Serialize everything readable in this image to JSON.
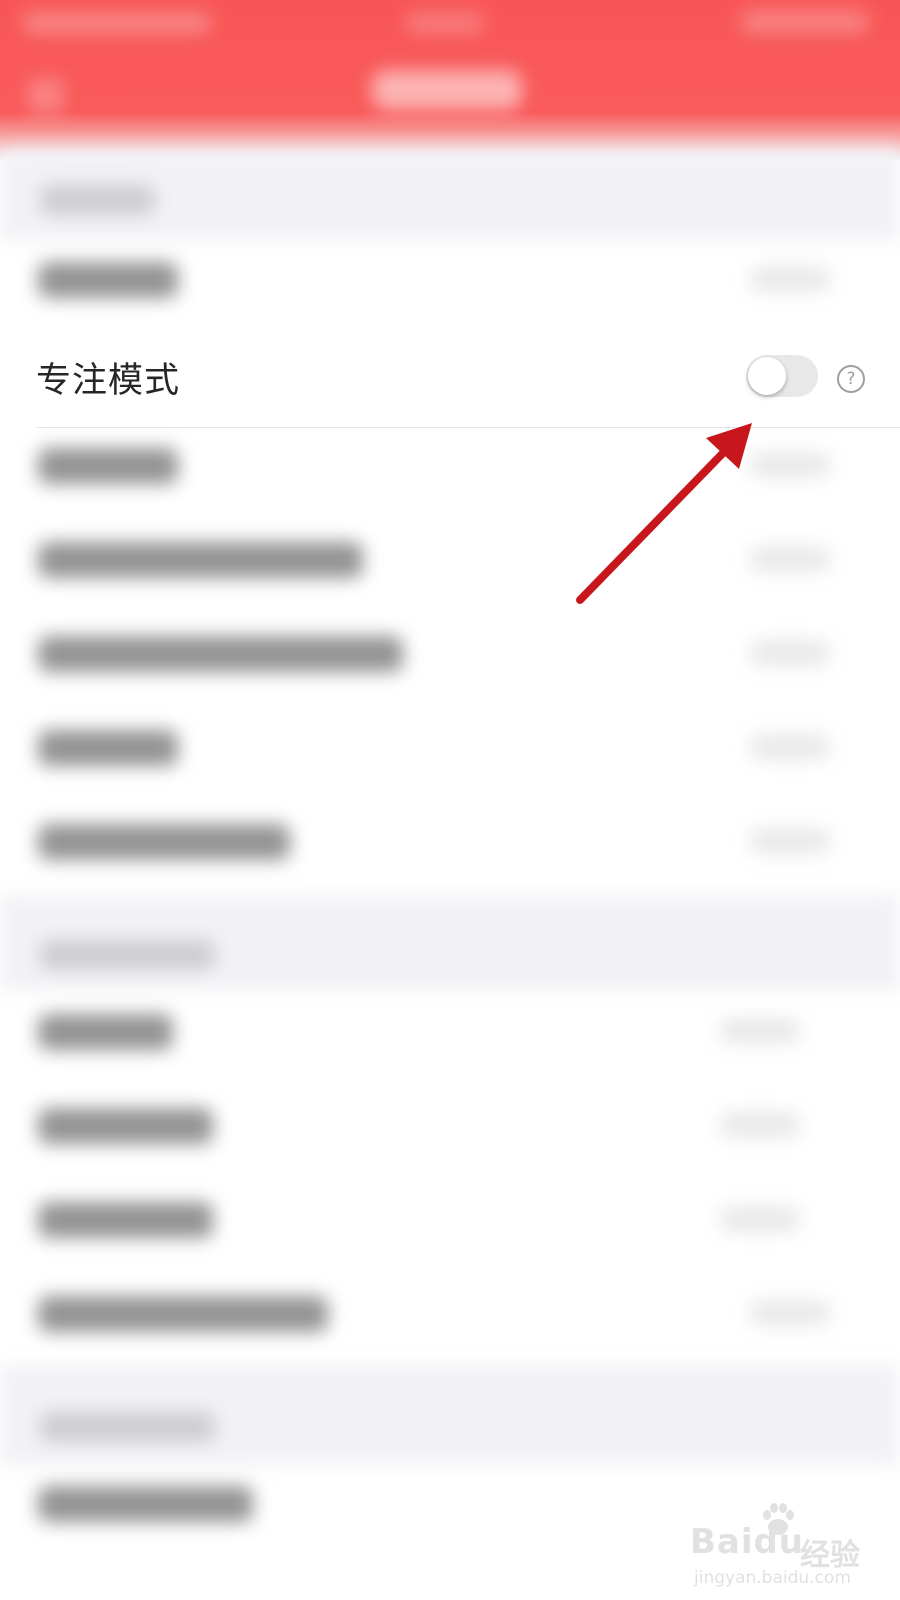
{
  "focus_mode": {
    "label": "专注模式",
    "enabled": false,
    "help_glyph": "?"
  },
  "watermark": {
    "brand": "Baidu",
    "brand_cn": "经验",
    "url": "jingyan.baidu.com"
  },
  "colors": {
    "header_red": "#f85656",
    "annotation_arrow": "#c8171c",
    "toggle_off": "#e8e8e8"
  },
  "icons": [
    "help-icon",
    "toggle-switch",
    "annotation-arrow"
  ]
}
